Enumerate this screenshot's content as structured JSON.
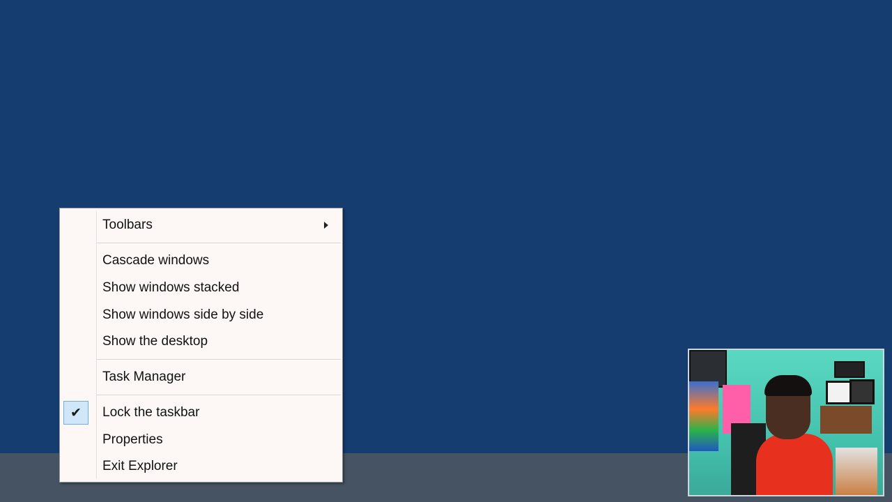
{
  "context_menu": {
    "toolbars": "Toolbars",
    "cascade": "Cascade windows",
    "stacked": "Show windows stacked",
    "side_by_side": "Show windows side by side",
    "show_desktop": "Show the desktop",
    "task_manager": "Task Manager",
    "lock_taskbar": "Lock the taskbar",
    "lock_taskbar_checked": true,
    "properties": "Properties",
    "exit_explorer": "Exit Explorer"
  },
  "colors": {
    "desktop": "#163d6f",
    "taskbar": "#465362",
    "menu_background": "#fdf8f6",
    "check_highlight": "#cfe7f8"
  },
  "icons": {
    "submenu": "chevron-right-icon",
    "check": "checkmark-icon"
  }
}
